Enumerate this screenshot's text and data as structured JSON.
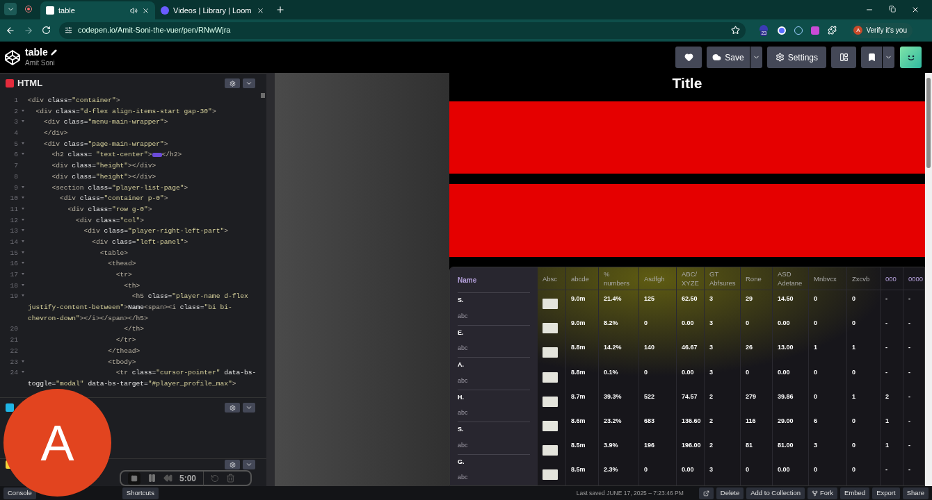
{
  "browser": {
    "tabs": [
      {
        "title": "table",
        "selected": true,
        "audio": true
      },
      {
        "title": "Videos | Library | Loom",
        "selected": false,
        "audio": false
      }
    ],
    "url": "codepen.io/Amit-Soni-the-vuer/pen/RNwWjra",
    "extension_badge": "23",
    "profile": {
      "initial": "A",
      "label": "Verify it's you"
    }
  },
  "header": {
    "title": "table",
    "author": "Amit Soni",
    "buttons": [
      {
        "kind": "heart"
      },
      {
        "kind": "save",
        "label": "Save"
      },
      {
        "kind": "settings",
        "label": "Settings"
      },
      {
        "kind": "layout"
      },
      {
        "kind": "bookmark"
      }
    ]
  },
  "editors": [
    {
      "kind": "html",
      "label": "HTML"
    },
    {
      "kind": "css"
    },
    {
      "kind": "js"
    }
  ],
  "code": [
    {
      "number": "1",
      "foldable": false,
      "parts": [
        "<div class=\"container\">"
      ]
    },
    {
      "number": "2",
      "foldable": true,
      "parts": [
        "  <div class=\"d-flex align-items-start gap-30\">"
      ]
    },
    {
      "number": "3",
      "foldable": true,
      "parts": [
        "    <div class=\"menu-main-wrapper\">"
      ]
    },
    {
      "number": "4",
      "foldable": false,
      "parts": [
        "    </div>"
      ]
    },
    {
      "number": "5",
      "foldable": true,
      "parts": [
        "    <div class=\"page-main-wrapper\">"
      ]
    },
    {
      "number": "6",
      "foldable": true,
      "parts": [
        "      <h2 class= \"text-center\">",
        "</h2>"
      ]
    },
    {
      "number": "7",
      "foldable": false,
      "parts": [
        "      <div class=\"height\"></div>"
      ]
    },
    {
      "number": "8",
      "foldable": false,
      "parts": [
        "      <div class=\"height\"></div>"
      ]
    },
    {
      "number": "9",
      "foldable": true,
      "parts": [
        "      <section class=\"player-list-page\">"
      ]
    },
    {
      "number": "10",
      "foldable": true,
      "parts": [
        "        <div class=\"container p-0\">"
      ]
    },
    {
      "number": "11",
      "foldable": true,
      "parts": [
        "          <div class=\"row g-0\">"
      ]
    },
    {
      "number": "12",
      "foldable": true,
      "parts": [
        "            <div class=\"col\">"
      ]
    },
    {
      "number": "13",
      "foldable": true,
      "parts": [
        "              <div class=\"player-right-left-part\">"
      ]
    },
    {
      "number": "14",
      "foldable": true,
      "parts": [
        "                <div class=\"left-panel\">"
      ]
    },
    {
      "number": "15",
      "foldable": true,
      "parts": [
        "                  <table>"
      ]
    },
    {
      "number": "16",
      "foldable": true,
      "parts": [
        "                    <thead>"
      ]
    },
    {
      "number": "17",
      "foldable": true,
      "parts": [
        "                      <tr>"
      ]
    },
    {
      "number": "18",
      "foldable": true,
      "parts": [
        "                        <th>"
      ]
    },
    {
      "number": "19",
      "foldable": true,
      "parts": [
        "                          <h5 class=\"player-name d-flex justify-content-between\">Name<span><i class=\"bi bi-chevron-down\"></i></span></h5>"
      ]
    },
    {
      "number": "20",
      "foldable": false,
      "parts": [
        "                        </th>"
      ]
    },
    {
      "number": "21",
      "foldable": false,
      "parts": [
        "                      </tr>"
      ]
    },
    {
      "number": "22",
      "foldable": false,
      "parts": [
        "                    </thead>"
      ]
    },
    {
      "number": "23",
      "foldable": true,
      "parts": [
        "                    <tbody>"
      ]
    },
    {
      "number": "24",
      "foldable": true,
      "parts": [
        "                      <tr class=\"cursor-pointer\" data-bs-toggle=\"modal\" data-bs-target=\"#player_profile_max\">"
      ]
    }
  ],
  "preview": {
    "title": "Title",
    "columns": [
      {
        "label": "Absc",
        "accent": false
      },
      {
        "label": "abcde",
        "accent": false
      },
      {
        "label": "% numbers",
        "accent": false
      },
      {
        "label": "Asdfgh",
        "accent": false
      },
      {
        "label": "ABC/ XYZE",
        "accent": false
      },
      {
        "label": "GT Abfsures",
        "accent": false
      },
      {
        "label": "Rone",
        "accent": false
      },
      {
        "label": "ASD Adetane",
        "accent": false
      },
      {
        "label": "Mnbvcx",
        "accent": false
      },
      {
        "label": "Zxcvb",
        "accent": false
      },
      {
        "label": "000",
        "accent": true
      },
      {
        "label": "0000",
        "accent": true
      }
    ],
    "name_heading": "Name",
    "names": [
      {
        "name": "S.",
        "sub": "abc"
      },
      {
        "name": "E.",
        "sub": "abc"
      },
      {
        "name": "A.",
        "sub": "abc"
      },
      {
        "name": "H.",
        "sub": "abc"
      },
      {
        "name": "S.",
        "sub": "abc"
      },
      {
        "name": "G.",
        "sub": "abc"
      }
    ],
    "rows": [
      [
        "",
        "9.0m",
        "21.4%",
        "125",
        "62.50",
        "3",
        "29",
        "14.50",
        "0",
        "0",
        "-",
        "-"
      ],
      [
        "",
        "9.0m",
        "8.2%",
        "0",
        "0.00",
        "3",
        "0",
        "0.00",
        "0",
        "0",
        "-",
        "-"
      ],
      [
        "",
        "8.8m",
        "14.2%",
        "140",
        "46.67",
        "3",
        "26",
        "13.00",
        "1",
        "1",
        "-",
        "-"
      ],
      [
        "",
        "8.8m",
        "0.1%",
        "0",
        "0.00",
        "3",
        "0",
        "0.00",
        "0",
        "0",
        "-",
        "-"
      ],
      [
        "",
        "8.7m",
        "39.3%",
        "522",
        "74.57",
        "2",
        "279",
        "39.86",
        "0",
        "1",
        "2",
        "-"
      ],
      [
        "",
        "8.6m",
        "23.2%",
        "683",
        "136.60",
        "2",
        "116",
        "29.00",
        "6",
        "0",
        "1",
        "-"
      ],
      [
        "",
        "8.5m",
        "3.9%",
        "196",
        "196.00",
        "2",
        "81",
        "81.00",
        "3",
        "0",
        "1",
        "-"
      ],
      [
        "",
        "8.5m",
        "2.3%",
        "0",
        "0.00",
        "3",
        "0",
        "0.00",
        "0",
        "0",
        "-",
        "-"
      ]
    ]
  },
  "loom": {
    "initial": "A",
    "timer": "5:00"
  },
  "footer": {
    "left_buttons": [
      "Console",
      "Shortcuts"
    ],
    "saved_label": "Last saved",
    "saved_date": "JUNE 17, 2025 – 7:23:46 PM",
    "right_buttons": [
      {
        "kind": "external"
      },
      {
        "kind": "text",
        "label": "Delete"
      },
      {
        "kind": "text",
        "label": "Add to Collection"
      },
      {
        "kind": "fork",
        "label": "Fork"
      },
      {
        "kind": "text",
        "label": "Embed"
      },
      {
        "kind": "text",
        "label": "Export"
      },
      {
        "kind": "text",
        "label": "Share"
      }
    ]
  }
}
